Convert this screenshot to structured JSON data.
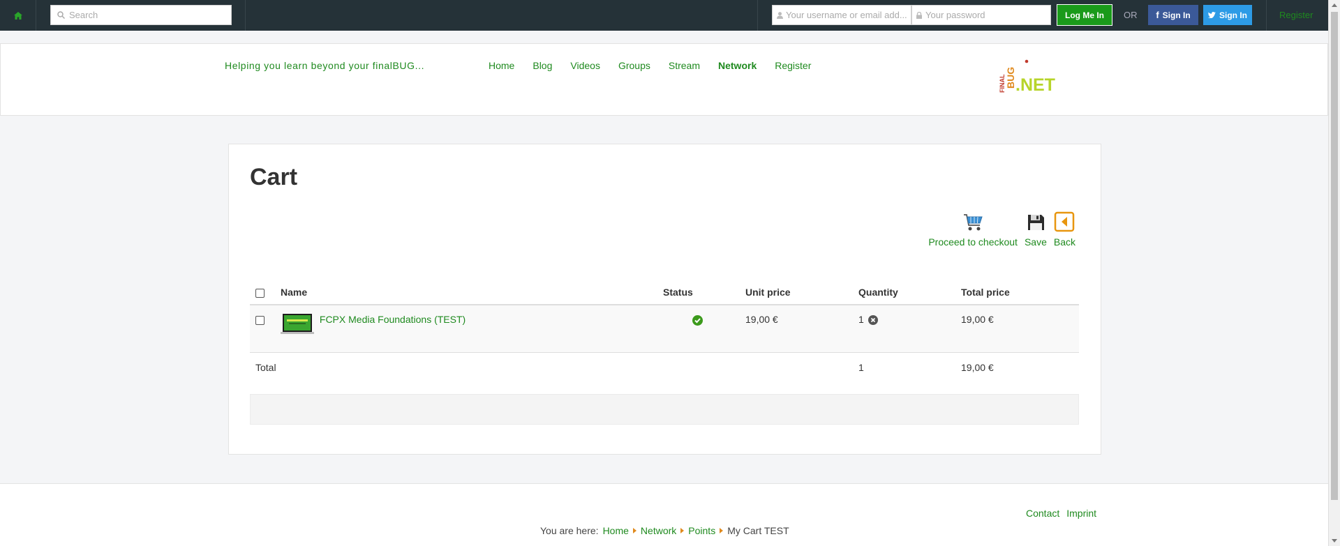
{
  "topbar": {
    "search_placeholder": "Search",
    "username_placeholder": "Your username or email add...",
    "password_placeholder": "Your password",
    "login_label": "Log Me In",
    "or_label": "OR",
    "facebook_label": "Sign In",
    "twitter_label": "Sign In",
    "register_label": "Register"
  },
  "header": {
    "tagline": "Helping you learn beyond your finalBUG...",
    "nav": [
      "Home",
      "Blog",
      "Videos",
      "Groups",
      "Stream",
      "Network",
      "Register"
    ],
    "active_nav": "Network",
    "logo_final": "FINAL",
    "logo_bug": "BUG",
    "logo_net": ".NET"
  },
  "cart": {
    "title": "Cart",
    "actions": {
      "checkout": "Proceed to checkout",
      "save": "Save",
      "back": "Back"
    },
    "columns": {
      "name": "Name",
      "status": "Status",
      "unit_price": "Unit price",
      "quantity": "Quantity",
      "total_price": "Total price"
    },
    "items": [
      {
        "name": "FCPX Media Foundations (TEST)",
        "unit_price": "19,00 €",
        "quantity": "1",
        "total_price": "19,00 €"
      }
    ],
    "total": {
      "label": "Total",
      "quantity": "1",
      "price": "19,00 €"
    }
  },
  "footer": {
    "contact": "Contact",
    "imprint": "Imprint",
    "you_are_here": "You are here:",
    "breadcrumb": [
      "Home",
      "Network",
      "Points"
    ],
    "current": "My Cart TEST"
  },
  "colors": {
    "accent_green": "#1f8a1f",
    "topbar_bg": "#253238",
    "facebook": "#3b5998",
    "twitter": "#2d9be6",
    "crumb_arrow": "#e08a1e"
  }
}
